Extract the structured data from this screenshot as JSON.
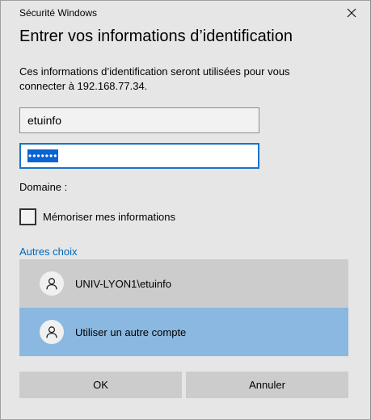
{
  "window": {
    "title": "Sécurité Windows"
  },
  "heading": "Entrer vos informations d’identification",
  "description": "Ces informations d’identification seront utilisées pour vous connecter à 192.168.77.34.",
  "username": {
    "value": "etuinfo"
  },
  "password": {
    "masked_value": "•••••••"
  },
  "domain_label": "Domaine :",
  "remember": {
    "label": "Mémoriser mes informations",
    "checked": false
  },
  "other_choices_label": "Autres choix",
  "accounts": [
    {
      "label": "UNIV-LYON1\\etuinfo",
      "icon": "user-icon"
    },
    {
      "label": "Utiliser un autre compte",
      "icon": "user-icon"
    }
  ],
  "buttons": {
    "ok": "OK",
    "cancel": "Annuler"
  },
  "colors": {
    "accent_link": "#0067b8",
    "selected_account": "#8ab8e0",
    "focus_border": "#1a73c8"
  }
}
